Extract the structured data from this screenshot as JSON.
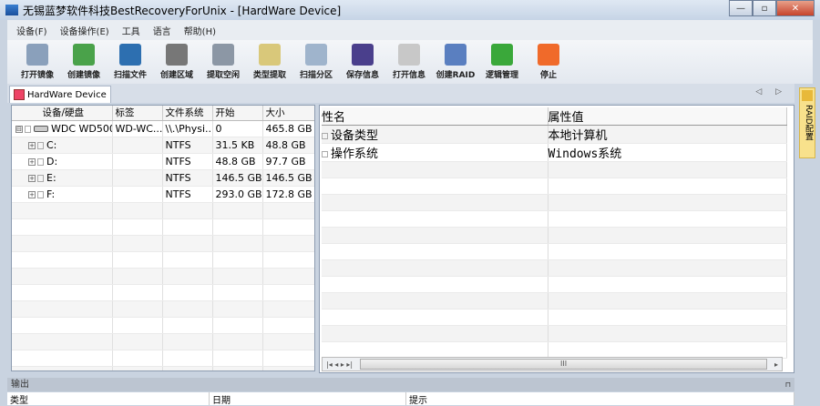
{
  "window": {
    "title": "无锡蓝梦软件科技BestRecoveryForUnix - [HardWare Device]",
    "minimize": "—",
    "maximize": "▫",
    "close": "✕"
  },
  "menu": [
    "设备(F)",
    "设备操作(E)",
    "工具",
    "语言",
    "帮助(H)"
  ],
  "toolbar": [
    {
      "label": "打开镜像",
      "icon": "open-image-icon",
      "color": "#8aa0bb"
    },
    {
      "label": "创建镜像",
      "icon": "create-image-icon",
      "color": "#4aa24a"
    },
    {
      "label": "扫描文件",
      "icon": "scan-file-icon",
      "color": "#2d6fb0"
    },
    {
      "label": "创建区域",
      "icon": "create-region-icon",
      "color": "#777777"
    },
    {
      "label": "提取空闲",
      "icon": "extract-free-icon",
      "color": "#8c97a5"
    },
    {
      "label": "类型提取",
      "icon": "type-extract-icon",
      "color": "#d9c87a"
    },
    {
      "label": "扫描分区",
      "icon": "scan-partition-icon",
      "color": "#9fb4cc"
    },
    {
      "label": "保存信息",
      "icon": "save-info-icon",
      "color": "#4a3f8c"
    },
    {
      "label": "打开信息",
      "icon": "open-info-icon",
      "color": "#c8c8c8"
    },
    {
      "label": "创建RAID",
      "icon": "create-raid-icon",
      "color": "#5a7fc0"
    },
    {
      "label": "逻辑管理",
      "icon": "logic-manage-icon",
      "color": "#3aa83a"
    },
    {
      "label": "停止",
      "icon": "stop-icon",
      "color": "#f06a2a"
    }
  ],
  "doc_tab": "HardWare Device",
  "tab_nav": "◁ ▷",
  "side_tab": "RAID配置",
  "device_table": {
    "columns": [
      "设备/硬盘",
      "标签",
      "文件系统",
      "开始",
      "大小"
    ],
    "rows": [
      {
        "name": "WDC WD500...",
        "label": "WD-WC...",
        "fs": "\\\\.\\Physi...",
        "start": "0",
        "size": "465.8 GB",
        "exp": "⊟"
      },
      {
        "name": "C:",
        "label": "",
        "fs": "NTFS",
        "start": "31.5 KB",
        "size": "48.8 GB",
        "exp": "+"
      },
      {
        "name": "D:",
        "label": "",
        "fs": "NTFS",
        "start": "48.8 GB",
        "size": "97.7 GB",
        "exp": "+"
      },
      {
        "name": "E:",
        "label": "",
        "fs": "NTFS",
        "start": "146.5 GB",
        "size": "146.5 GB",
        "exp": "+"
      },
      {
        "name": "F:",
        "label": "",
        "fs": "NTFS",
        "start": "293.0 GB",
        "size": "172.8 GB",
        "exp": "+"
      }
    ]
  },
  "property_table": {
    "columns": [
      "性名",
      "属性值"
    ],
    "rows": [
      {
        "name": "设备类型",
        "value": "本地计算机"
      },
      {
        "name": "操作系统",
        "value": "Windows系统"
      }
    ]
  },
  "scroll": {
    "nav": "|◂ ◂ ▸ ▸|",
    "thumb": "III",
    "right": "▸"
  },
  "output": {
    "title": "输出",
    "pin": "⊓",
    "columns": [
      "类型",
      "日期",
      "提示"
    ]
  }
}
